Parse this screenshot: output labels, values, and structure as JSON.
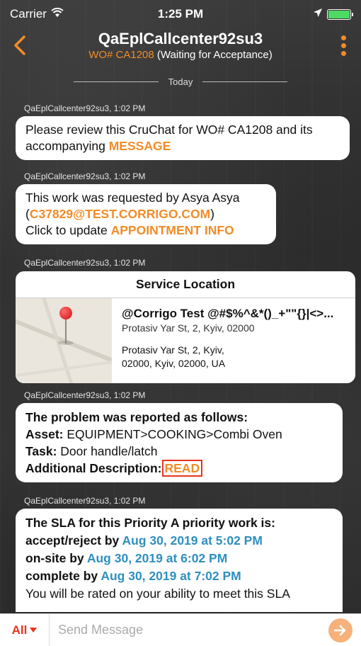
{
  "status_bar": {
    "carrier": "Carrier",
    "time": "1:25 PM"
  },
  "header": {
    "title": "QaEplCallcenter92su3",
    "wo_label": "WO# CA1208",
    "wo_status": "(Waiting for Acceptance)"
  },
  "day_separator": "Today",
  "messages": [
    {
      "sender": "QaEplCallcenter92su3, 1:02 PM",
      "text_1": "Please review this CruChat for WO# CA1208 and its accompanying ",
      "link": "MESSAGE"
    },
    {
      "sender": "QaEplCallcenter92su3, 1:02 PM",
      "text_1": "This work was requested by Asya Asya",
      "paren_open": "(",
      "email": "C37829@TEST.CORRIGO.COM",
      "paren_close": ")",
      "text_2": "Click to update ",
      "link": "APPOINTMENT INFO"
    },
    {
      "sender": "QaEplCallcenter92su3, 1:02 PM",
      "card_title": "Service Location",
      "location_name": "@Corrigo Test @#$%^&*()_+\"\"{}|<>...",
      "location_short": "Protasiv Yar St, 2, Kyiv, 02000",
      "location_full_1": "Protasiv Yar St, 2, Kyiv,",
      "location_full_2": "02000, Kyiv,  02000, UA"
    },
    {
      "sender": "QaEplCallcenter92su3, 1:02 PM",
      "heading": "The problem was reported as follows:",
      "asset_label": "Asset:",
      "asset_value": " EQUIPMENT>COOKING>Combi Oven",
      "task_label": "Task:",
      "task_value": " Door handle/latch",
      "desc_label": "Additional Description:",
      "desc_link": "READ"
    },
    {
      "sender": "QaEplCallcenter92su3, 1:02 PM",
      "heading": "The SLA for this Priority A priority work is:",
      "accept_label": "accept/reject by ",
      "accept_date": "Aug 30, 2019 at 5:02 PM",
      "onsite_label": "on-site by ",
      "onsite_date": "Aug 30, 2019 at 6:02 PM",
      "complete_label": "complete by ",
      "complete_date": "Aug 30, 2019 at 7:02 PM",
      "footer": "You will be rated on your ability to meet this SLA"
    }
  ],
  "composer": {
    "recipient": "All",
    "placeholder": "Send Message"
  },
  "colors": {
    "accent": "#f28c28",
    "link_blue": "#2d8fbf",
    "highlight_red": "#e8331c"
  }
}
